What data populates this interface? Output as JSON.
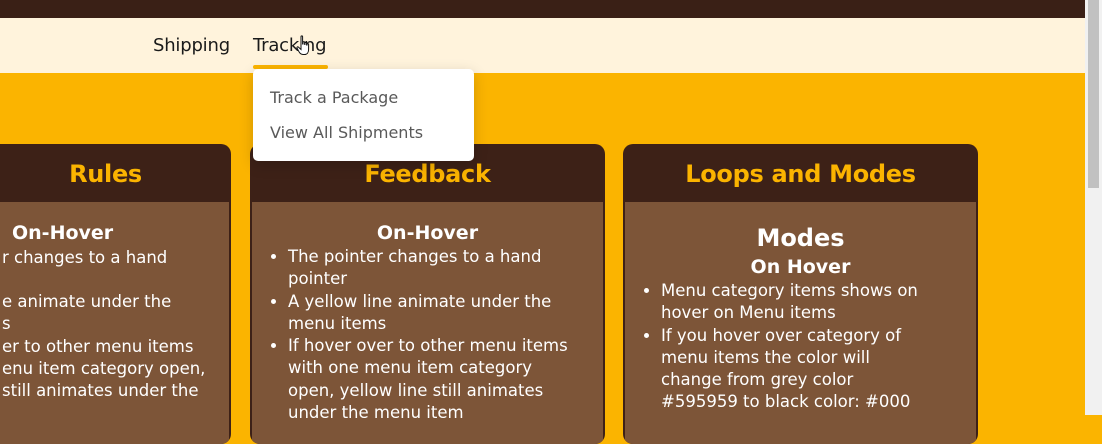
{
  "nav": {
    "items": [
      {
        "label": "Shipping"
      },
      {
        "label": "Tracking"
      }
    ],
    "dropdown": [
      "Track a Package",
      "View All Shipments"
    ]
  },
  "cards": [
    {
      "title": "Rules",
      "heading": "On-Hover",
      "lines": [
        "r changes to a hand",
        "e animate under the",
        "s",
        "er to other menu items",
        "enu item category open,",
        " still animates under the"
      ]
    },
    {
      "title": "Feedback",
      "heading": "On-Hover",
      "items": [
        "The pointer changes to a hand pointer",
        "A yellow line animate under the menu items",
        "If hover over to other menu items with one menu item category open, yellow line still animates under the menu item"
      ]
    },
    {
      "title": "Loops and Modes",
      "heading": "Modes",
      "subheading": "On Hover",
      "items": [
        "Menu category items shows on hover on Menu items",
        "If you hover over category of menu items the color will change from grey color #595959 to black color: #000"
      ]
    }
  ],
  "colors": {
    "background": "#fbb400",
    "topbar": "#3a2016",
    "navbar": "#fff3dc",
    "card_header": "#3d2117",
    "card_body": "#7d5538",
    "dropdown_text": "#595959"
  }
}
